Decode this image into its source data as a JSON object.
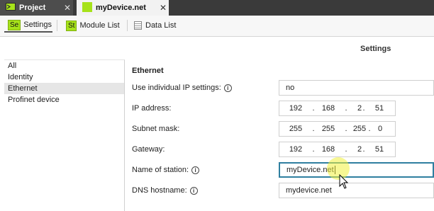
{
  "tabs": [
    {
      "label": "Project",
      "icon": "folder-icon",
      "close": "✕"
    },
    {
      "label": "myDevice.net",
      "icon": "device-icon",
      "close": "✕"
    }
  ],
  "toolbar": {
    "settings": {
      "badge": "Se",
      "label": "Settings"
    },
    "module_list": {
      "badge": "St",
      "label": "Module List"
    },
    "data_list": {
      "label": "Data List",
      "icon": "grid-icon"
    }
  },
  "page_title": "Settings",
  "nav": [
    "All",
    "Identity",
    "Ethernet",
    "Profinet device"
  ],
  "nav_active": "Ethernet",
  "form": {
    "section": "Ethernet",
    "use_individual_ip": {
      "label": "Use individual IP settings:",
      "value": "no"
    },
    "ip_address": {
      "label": "IP address:",
      "octets": [
        "192",
        "168",
        "2",
        "51"
      ]
    },
    "subnet_mask": {
      "label": "Subnet mask:",
      "octets": [
        "255",
        "255",
        "255",
        "0"
      ]
    },
    "gateway": {
      "label": "Gateway:",
      "octets": [
        "192",
        "168",
        "2",
        "51"
      ]
    },
    "name_of_station": {
      "label": "Name of station:",
      "value": "myDevice.net"
    },
    "dns_hostname": {
      "label": "DNS hostname:",
      "value": "mydevice.net"
    }
  },
  "info_glyph": "i",
  "dot_glyph": "."
}
